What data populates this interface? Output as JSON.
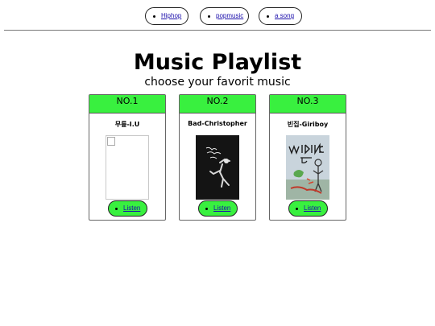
{
  "nav": {
    "items": [
      {
        "label": "Hiphop"
      },
      {
        "label": "popmusic"
      },
      {
        "label": "a song"
      }
    ]
  },
  "header": {
    "title": "Music Playlist",
    "subtitle": "choose your favorit music"
  },
  "cards": [
    {
      "rank": "NO.1",
      "song": "무릎-I.U",
      "listen_label": "Listen",
      "cover": "broken-image-icon"
    },
    {
      "rank": "NO.2",
      "song": "Bad-Christopher",
      "listen_label": "Listen",
      "cover": "album-cover-bad"
    },
    {
      "rank": "NO.3",
      "song": "빈집-Giriboy",
      "listen_label": "Listen",
      "cover": "album-cover-walking-dead"
    }
  ],
  "colors": {
    "accent": "#39f03f",
    "link": "#1a0dab"
  }
}
